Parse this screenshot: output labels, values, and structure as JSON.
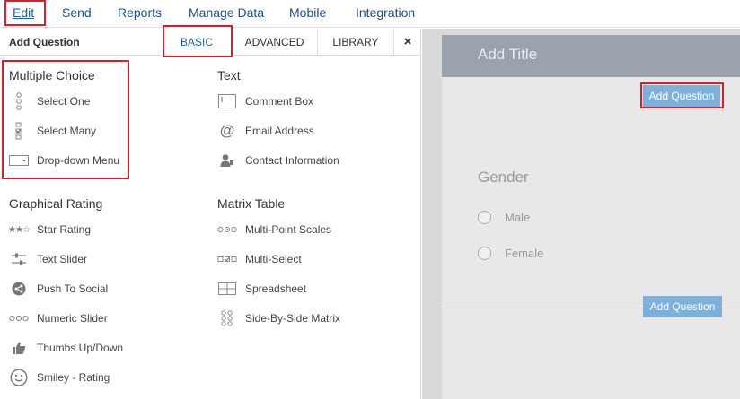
{
  "topnav": {
    "items": [
      "Edit",
      "Send",
      "Reports",
      "Manage Data",
      "Mobile",
      "Integration"
    ]
  },
  "panel": {
    "title": "Add Question",
    "tabs": [
      "BASIC",
      "ADVANCED",
      "LIBRARY"
    ],
    "close_label": "×"
  },
  "sections": {
    "multiple_choice": {
      "title": "Multiple Choice",
      "items": [
        {
          "label": "Select One",
          "icon": "radio-list-icon"
        },
        {
          "label": "Select Many",
          "icon": "checkbox-list-icon"
        },
        {
          "label": "Drop-down Menu",
          "icon": "dropdown-icon"
        }
      ]
    },
    "text": {
      "title": "Text",
      "items": [
        {
          "label": "Comment Box",
          "icon": "comment-box-icon"
        },
        {
          "label": "Email Address",
          "icon": "at-sign-icon"
        },
        {
          "label": "Contact Information",
          "icon": "contact-icon"
        }
      ]
    },
    "graphical_rating": {
      "title": "Graphical Rating",
      "items": [
        {
          "label": "Star Rating",
          "icon": "star-icon"
        },
        {
          "label": "Text Slider",
          "icon": "slider-icon"
        },
        {
          "label": "Push To Social",
          "icon": "share-icon"
        },
        {
          "label": "Numeric Slider",
          "icon": "numeric-slider-icon"
        },
        {
          "label": "Thumbs Up/Down",
          "icon": "thumbs-up-icon"
        },
        {
          "label": "Smiley - Rating",
          "icon": "smiley-icon"
        }
      ]
    },
    "matrix_table": {
      "title": "Matrix Table",
      "items": [
        {
          "label": "Multi-Point Scales",
          "icon": "multi-point-icon"
        },
        {
          "label": "Multi-Select",
          "icon": "multi-select-icon"
        },
        {
          "label": "Spreadsheet",
          "icon": "spreadsheet-icon"
        },
        {
          "label": "Side-By-Side Matrix",
          "icon": "side-by-side-icon"
        }
      ]
    }
  },
  "canvas": {
    "title_placeholder": "Add Title",
    "add_question_top": "Add Question",
    "add_question_bottom": "Add Question",
    "question": {
      "label": "Gender",
      "options": [
        "Male",
        "Female"
      ]
    }
  },
  "colors": {
    "accent": "#1f5fa8",
    "highlight": "#d6202a",
    "button": "#7eb0dc",
    "title_bar": "#9aa3ad"
  }
}
